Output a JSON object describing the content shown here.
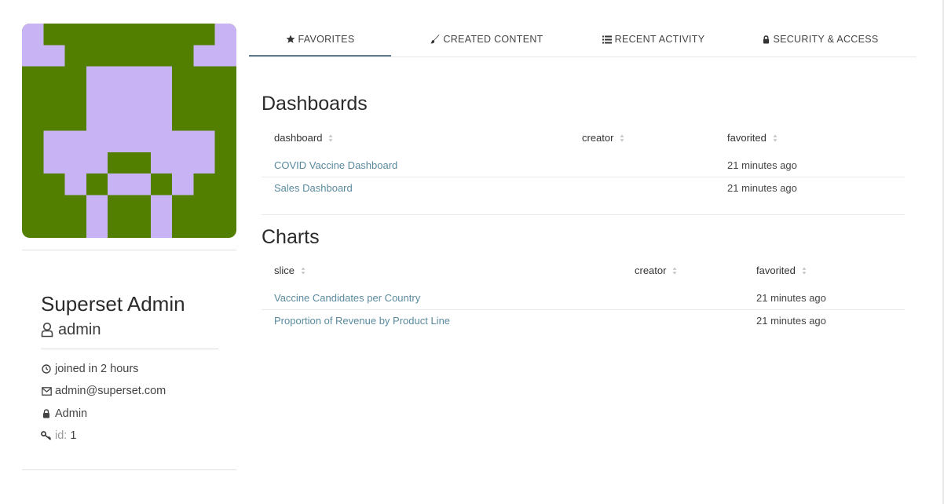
{
  "profile": {
    "name": "Superset Admin",
    "username": "admin",
    "joined": "joined in 2 hours",
    "email": "admin@superset.com",
    "role": "Admin",
    "id_label": "id:",
    "id_value": "1",
    "avatar_colors": {
      "background": "#527f00",
      "foreground": "#c8b4f4"
    }
  },
  "tabs": [
    {
      "label": "FAVORITES",
      "icon": "star-icon",
      "active": true
    },
    {
      "label": "CREATED CONTENT",
      "icon": "paintbrush-icon",
      "active": false
    },
    {
      "label": "RECENT ACTIVITY",
      "icon": "list-icon",
      "active": false
    },
    {
      "label": "SECURITY & ACCESS",
      "icon": "lock-icon",
      "active": false
    }
  ],
  "dashboards": {
    "title": "Dashboards",
    "columns": [
      "dashboard",
      "creator",
      "favorited"
    ],
    "rows": [
      {
        "name": "COVID Vaccine Dashboard",
        "creator": "",
        "favorited": "21 minutes ago"
      },
      {
        "name": "Sales Dashboard",
        "creator": "",
        "favorited": "21 minutes ago"
      }
    ]
  },
  "charts": {
    "title": "Charts",
    "columns": [
      "slice",
      "creator",
      "favorited"
    ],
    "rows": [
      {
        "name": "Vaccine Candidates per Country",
        "creator": "",
        "favorited": "21 minutes ago"
      },
      {
        "name": "Proportion of Revenue by Product Line",
        "creator": "",
        "favorited": "21 minutes ago"
      }
    ]
  },
  "colors": {
    "link": "#5a8a9e",
    "active_tab_underline": "#5f7a8c"
  }
}
